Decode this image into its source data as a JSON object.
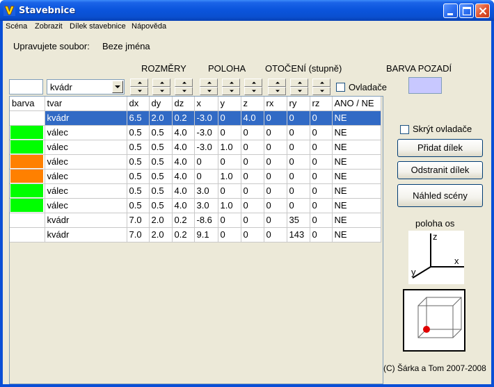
{
  "window": {
    "title": "Stavebnice"
  },
  "menu": [
    "Scéna",
    "Zobrazit",
    "Dílek stavebnice",
    "Nápověda"
  ],
  "file": {
    "label": "Upravujete soubor:",
    "name": "Beze jména"
  },
  "section_headers": {
    "rozmery": "ROZMĚRY",
    "poloha": "POLOHA",
    "otoceni": "OTOČENÍ (stupně)",
    "barva_pozadi": "BARVA POZADÍ"
  },
  "shape_select": {
    "value": "kvádr"
  },
  "controls": {
    "ovladace_label": "Ovladače",
    "skryt_label": "Skrýt ovladače"
  },
  "colors": {
    "background_swatch": "#c8c8ff",
    "selection": "#316ac5",
    "green": "#00ff00",
    "orange": "#ff8000",
    "white": "#ffffff"
  },
  "table": {
    "columns": [
      "barva",
      "tvar",
      "dx",
      "dy",
      "dz",
      "x",
      "y",
      "z",
      "rx",
      "ry",
      "rz",
      "ANO / NE"
    ],
    "rows": [
      {
        "color": "#ffffff",
        "cells": [
          "kvádr",
          "6.5",
          "2.0",
          "0.2",
          "-3.0",
          "0",
          "4.0",
          "0",
          "0",
          "0",
          "NE"
        ],
        "selected": true
      },
      {
        "color": "#00ff00",
        "cells": [
          "válec",
          "0.5",
          "0.5",
          "4.0",
          "-3.0",
          "0",
          "0",
          "0",
          "0",
          "0",
          "NE"
        ]
      },
      {
        "color": "#00ff00",
        "cells": [
          "válec",
          "0.5",
          "0.5",
          "4.0",
          "-3.0",
          "1.0",
          "0",
          "0",
          "0",
          "0",
          "NE"
        ]
      },
      {
        "color": "#ff8000",
        "cells": [
          "válec",
          "0.5",
          "0.5",
          "4.0",
          "0",
          "0",
          "0",
          "0",
          "0",
          "0",
          "NE"
        ]
      },
      {
        "color": "#ff8000",
        "cells": [
          "válec",
          "0.5",
          "0.5",
          "4.0",
          "0",
          "1.0",
          "0",
          "0",
          "0",
          "0",
          "NE"
        ]
      },
      {
        "color": "#00ff00",
        "cells": [
          "válec",
          "0.5",
          "0.5",
          "4.0",
          "3.0",
          "0",
          "0",
          "0",
          "0",
          "0",
          "NE"
        ]
      },
      {
        "color": "#00ff00",
        "cells": [
          "válec",
          "0.5",
          "0.5",
          "4.0",
          "3.0",
          "1.0",
          "0",
          "0",
          "0",
          "0",
          "NE"
        ]
      },
      {
        "color": "#ffffff",
        "cells": [
          "kvádr",
          "7.0",
          "2.0",
          "0.2",
          "-8.6",
          "0",
          "0",
          "0",
          "35",
          "0",
          "NE"
        ]
      },
      {
        "color": "#ffffff",
        "cells": [
          "kvádr",
          "7.0",
          "2.0",
          "0.2",
          "9.1",
          "0",
          "0",
          "0",
          "143",
          "0",
          "NE"
        ]
      }
    ]
  },
  "buttons": {
    "pridat": "Přidat dílek",
    "odstranit": "Odstranit dílek",
    "nahled": "Náhled scény"
  },
  "axes": {
    "title": "poloha os",
    "z": "z",
    "x": "x",
    "y": "y"
  },
  "copyright": "(C) Šárka a Tom 2007-2008",
  "icons": {
    "app": "app-logo-icon",
    "minimize": "minimize-icon",
    "maximize": "maximize-icon",
    "close": "close-icon"
  }
}
